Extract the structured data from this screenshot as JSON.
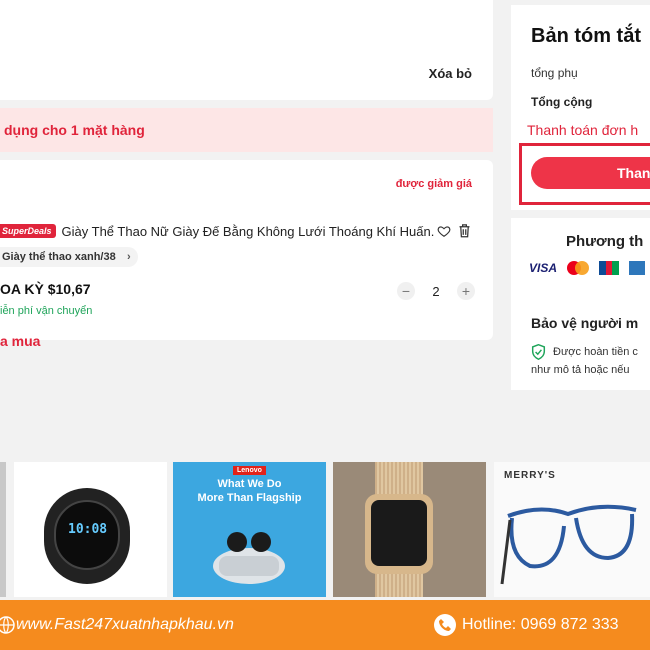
{
  "cart": {
    "delete_label": "Xóa bỏ",
    "promo_text": "dụng cho 1 mặt hàng",
    "discount_link": "được giảm giá",
    "buy_label": "a mua",
    "item": {
      "badge": "SuperDeals",
      "title": "Giày Thể Thao Nữ Giày Đế Bằng Không Lưới Thoáng Khí Huấn...",
      "variant": "Giày thể thao xanh/38",
      "price": "OA KỲ $10,67",
      "shipping": "iễn phí vận chuyển",
      "quantity": "2",
      "qty_minus": "−",
      "qty_plus": "+"
    }
  },
  "summary": {
    "title": "Bản tóm tắt",
    "subtotal_label": "tổng phụ",
    "total_label": "Tổng cộng",
    "note": "Thanh toán đơn h",
    "checkout_label": "Than"
  },
  "payment": {
    "title": "Phương th",
    "cards": [
      "VISA",
      "mastercard-icon",
      "jcb-icon",
      "amex-icon"
    ],
    "visa_label": "VISA",
    "protection_title": "Bảo vệ người m",
    "protection_line1": "Được hoàn tiền c",
    "protection_line2": "như mô tả hoặc nếu"
  },
  "products": {
    "p2_brand": "Lenovo",
    "p2_line1": "What We Do",
    "p2_line2": "More Than Flagship",
    "p4_brand": "MERRY'S"
  },
  "footer": {
    "website": "www.Fast247xuatnhapkhau.vn",
    "hotline": "Hotline: 0969 872 333"
  },
  "colors": {
    "accent": "#e0243b",
    "footer": "#f58b1e",
    "green": "#1fa45a"
  }
}
